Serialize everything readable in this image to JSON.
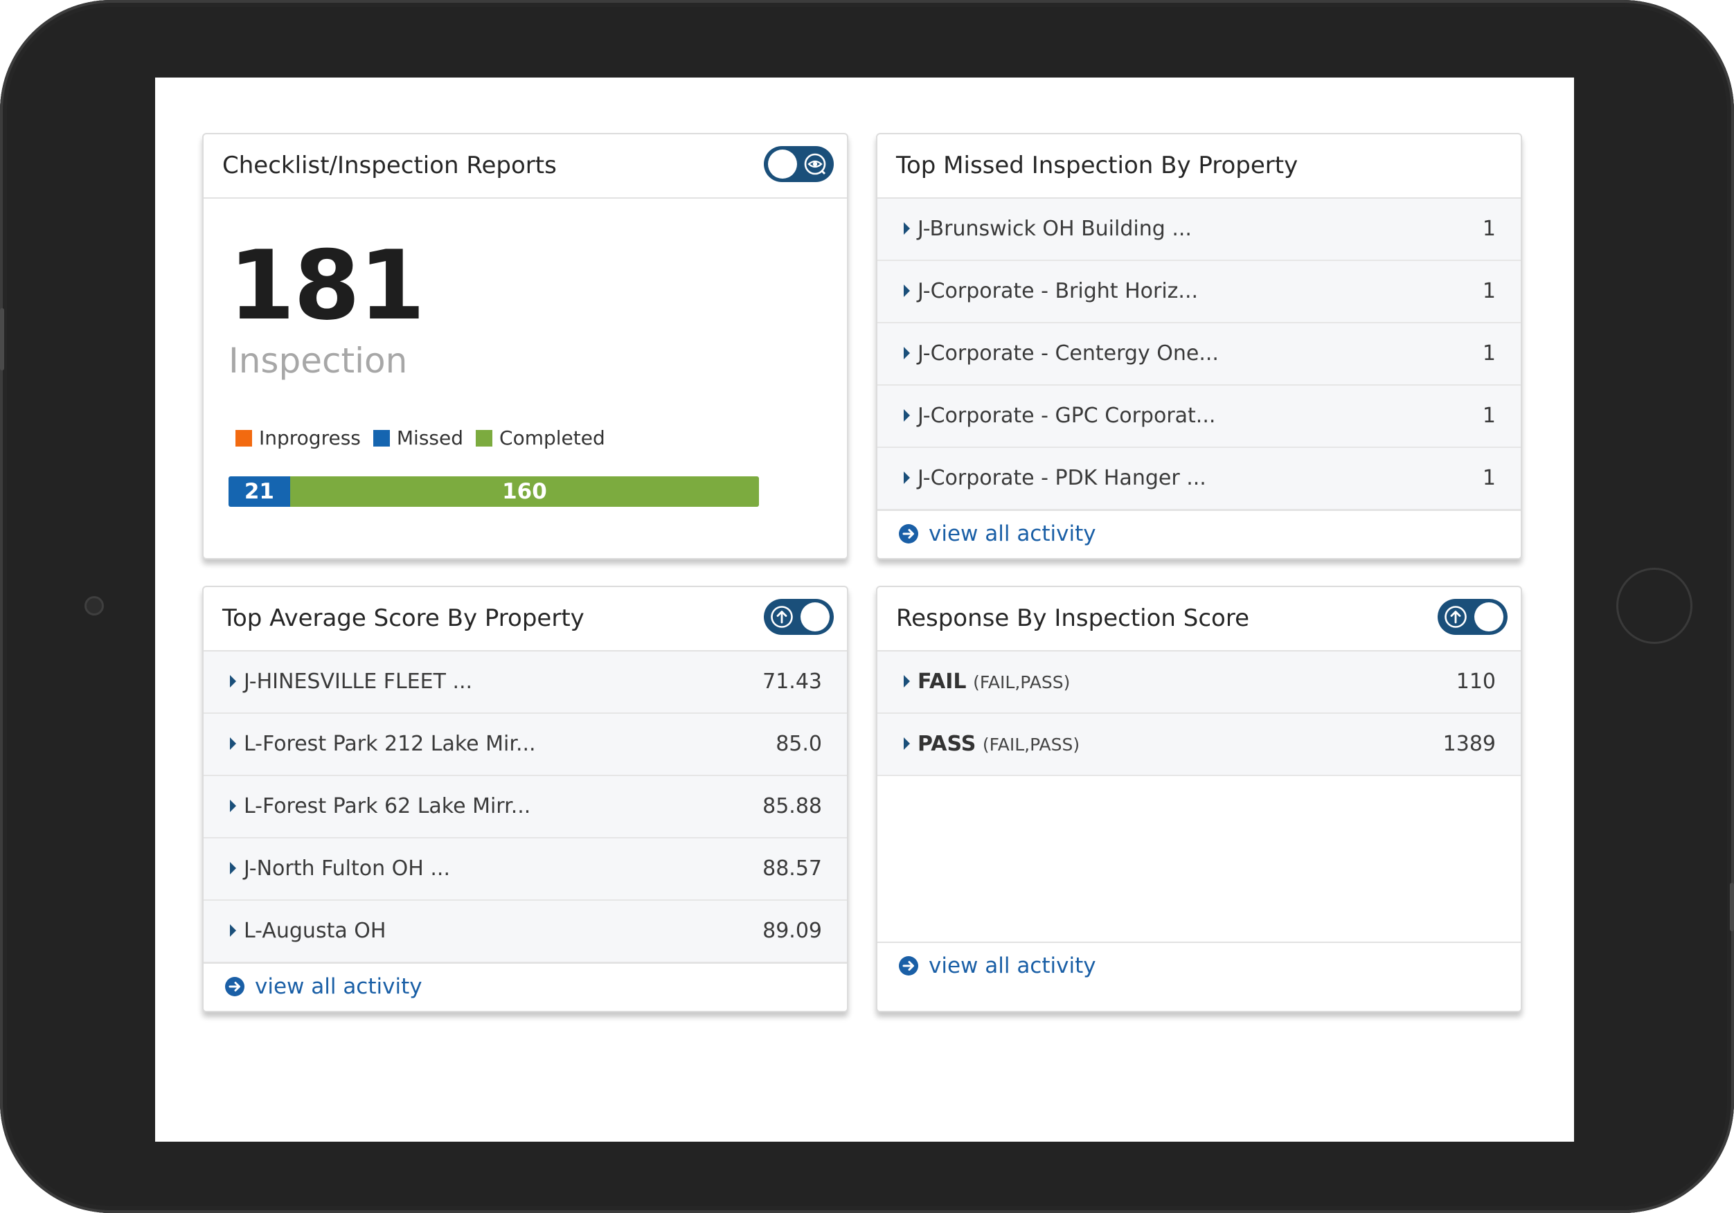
{
  "colors": {
    "accent": "#1a4f7a",
    "link": "#1a5fa6",
    "inprogress": "#f26a10",
    "missed": "#1565b0",
    "completed": "#7cab3f"
  },
  "checklist": {
    "title": "Checklist/Inspection Reports",
    "total": "181",
    "total_label": "Inspection",
    "legend": [
      {
        "label": "Inprogress",
        "color": "#f26a10"
      },
      {
        "label": "Missed",
        "color": "#1565b0"
      },
      {
        "label": "Completed",
        "color": "#7cab3f"
      }
    ],
    "bar": {
      "missed": "21",
      "completed": "160",
      "missed_fraction": 0.116
    },
    "toggle_icon": "eye-search-icon"
  },
  "missed": {
    "title": "Top Missed Inspection By Property",
    "rows": [
      {
        "name": "J-Brunswick OH Building ...",
        "value": "1"
      },
      {
        "name": "J-Corporate - Bright Horiz...",
        "value": "1"
      },
      {
        "name": "J-Corporate - Centergy One...",
        "value": "1"
      },
      {
        "name": "J-Corporate - GPC Corporat...",
        "value": "1"
      },
      {
        "name": "J-Corporate - PDK Hanger ...",
        "value": "1"
      }
    ],
    "link": "view all activity"
  },
  "average": {
    "title": "Top Average Score By Property",
    "rows": [
      {
        "name": "J-HINESVILLE FLEET ...",
        "value": "71.43"
      },
      {
        "name": "L-Forest Park 212 Lake Mir...",
        "value": "85.0"
      },
      {
        "name": "L-Forest Park 62 Lake Mirr...",
        "value": "85.88"
      },
      {
        "name": "J-North Fulton OH ...",
        "value": "88.57"
      },
      {
        "name": "L-Augusta OH",
        "value": "89.09"
      }
    ],
    "link": "view all activity",
    "toggle_icon": "arrow-up-circle-icon"
  },
  "response": {
    "title": "Response By Inspection Score",
    "rows": [
      {
        "name": "FAIL",
        "sub": "(FAIL,PASS)",
        "value": "110"
      },
      {
        "name": "PASS",
        "sub": "(FAIL,PASS)",
        "value": "1389"
      }
    ],
    "link": "view all activity",
    "toggle_icon": "arrow-up-circle-icon"
  }
}
